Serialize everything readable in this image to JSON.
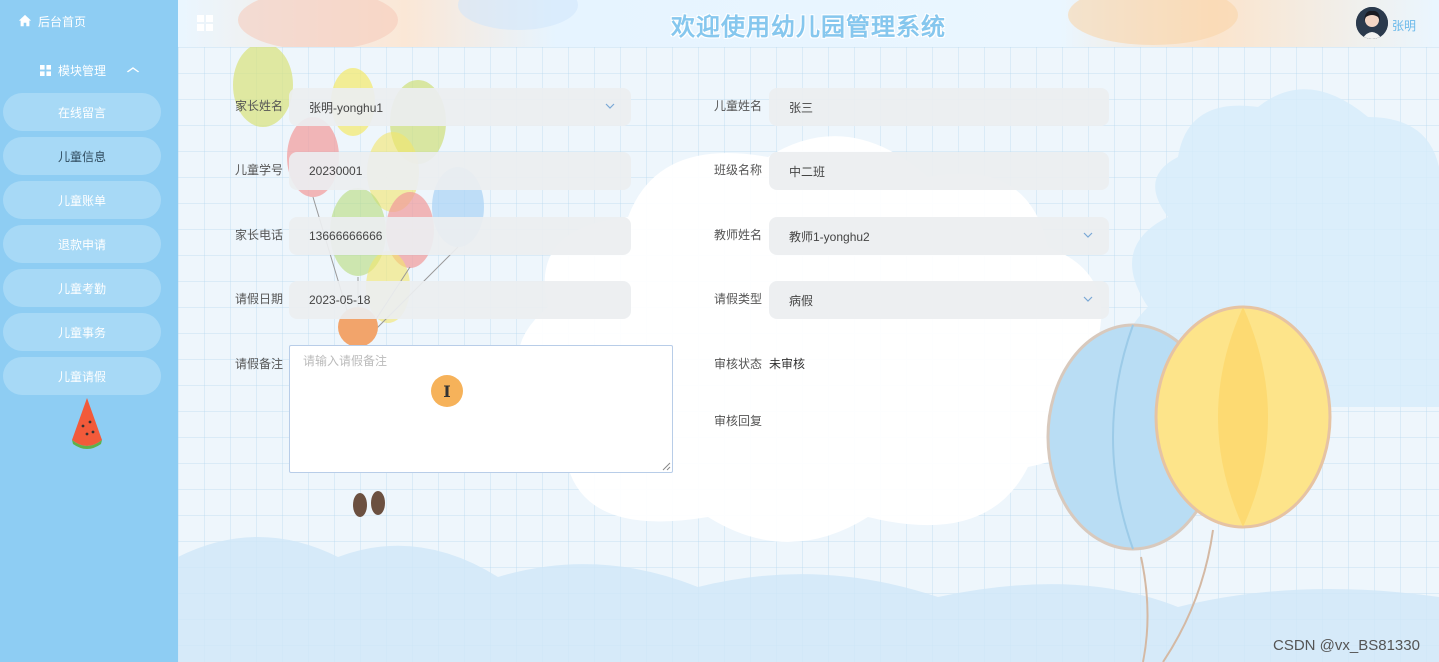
{
  "sidebar": {
    "home_label": "后台首页",
    "group_label": "模块管理",
    "items": [
      {
        "label": "在线留言"
      },
      {
        "label": "儿童信息"
      },
      {
        "label": "儿童账单"
      },
      {
        "label": "退款申请"
      },
      {
        "label": "儿童考勤"
      },
      {
        "label": "儿童事务"
      },
      {
        "label": "儿童请假"
      }
    ]
  },
  "header": {
    "title": "欢迎使用幼儿园管理系统",
    "username": "张明"
  },
  "form": {
    "parent_name": {
      "label": "家长姓名",
      "value": "张明-yonghu1"
    },
    "child_name": {
      "label": "儿童姓名",
      "value": "张三"
    },
    "student_id": {
      "label": "儿童学号",
      "value": "20230001"
    },
    "class_name": {
      "label": "班级名称",
      "value": "中二班"
    },
    "parent_phone": {
      "label": "家长电话",
      "value": "13666666666"
    },
    "teacher_name": {
      "label": "教师姓名",
      "value": "教师1-yonghu2"
    },
    "leave_date": {
      "label": "请假日期",
      "value": "2023-05-18"
    },
    "leave_type": {
      "label": "请假类型",
      "value": "病假"
    },
    "leave_note": {
      "label": "请假备注",
      "placeholder": "请输入请假备注"
    },
    "review_status": {
      "label": "审核状态",
      "value": "未审核"
    },
    "review_reply": {
      "label": "审核回复"
    }
  },
  "watermark": "CSDN @vx_BS81330",
  "colors": {
    "sidebar_bg": "#8ecdf3",
    "menu_item_bg": "#a7d9f6",
    "title_color": "#86c7ee"
  }
}
